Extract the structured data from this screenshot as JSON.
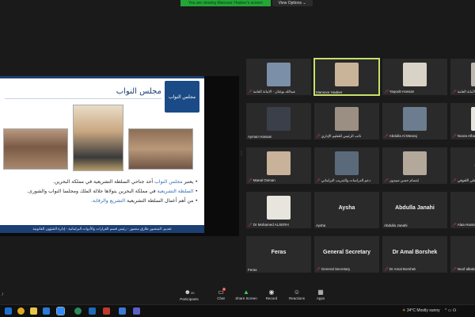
{
  "banner": {
    "share_text": "You are viewing Mansoor Hadeer's screen",
    "view_options": "View Options ⌄"
  },
  "slide": {
    "title": "مجلس النواب",
    "logo_text": "مجلس النواب",
    "bullets": [
      {
        "pre": "يعتبر ",
        "hl": "مجلس النواب",
        "post": " أحد جناحي السلطة التشريعية في مملكة البحرين."
      },
      {
        "pre": "",
        "hl": "السلطة التشريعية",
        "post": " في مملكة البحرين يتولاها جلالة الملك ومجلسا النواب والشورى."
      },
      {
        "pre": "من أهم أعمال السلطة التشريعية ",
        "hl": "التشريع والرقابة.",
        "post": ""
      }
    ],
    "footer": "تقديم: المنصور طارق منصور - رئيس قسم القرارات والأدوات البرلمانية - إدارة الشؤون القانونية"
  },
  "participants": [
    {
      "name": "عبدالله بوغتان - الامانة العامة",
      "muted": true,
      "kind": "photo",
      "color": "#7b8fa8"
    },
    {
      "name": "Mansoor Hadeer",
      "muted": false,
      "kind": "photo",
      "color": "#c9b49a",
      "active": true
    },
    {
      "name": "Yaqoob Hassan",
      "muted": true,
      "kind": "photo",
      "color": "#d9d2c6"
    },
    {
      "name": "الأمانة العامة",
      "muted": true,
      "kind": "photo",
      "color": "#bdb7ae"
    },
    {
      "name": "Ayman Hassan",
      "muted": false,
      "kind": "photo",
      "color": "#3a3f4a"
    },
    {
      "name": "نائب الرئيس للتعليم الإداري",
      "muted": true,
      "kind": "photo",
      "color": "#9a8f82"
    },
    {
      "name": "Abdulla Al Mearaj",
      "muted": true,
      "kind": "photo",
      "color": "#6b7d8f"
    },
    {
      "name": "Noora Alhamadi",
      "muted": true,
      "kind": "photo",
      "color": "#e6e2dc"
    },
    {
      "name": "Manal Osman",
      "muted": true,
      "kind": "photo",
      "color": "#c8b29a"
    },
    {
      "name": "دعم الدراسات والتدريب البرلماني",
      "muted": true,
      "kind": "photo",
      "color": "#5a6a7a"
    },
    {
      "name": "ابتسام حسن سيدون",
      "muted": true,
      "kind": "photo",
      "color": "#b4a89a"
    },
    {
      "name": "علي اللعوفي",
      "muted": true,
      "kind": "text",
      "label": "علي ال"
    },
    {
      "name": "Dr Mohamed ALSERH",
      "muted": true,
      "kind": "photo",
      "color": "#e8e4de"
    },
    {
      "name": "Aysha",
      "muted": false,
      "kind": "text",
      "label": "Aysha"
    },
    {
      "name": "Abdulla Janahi",
      "muted": false,
      "kind": "text",
      "label": "Abdulla Janahi"
    },
    {
      "name": "Alaa Hassan",
      "muted": true,
      "kind": "text",
      "label": "Ala"
    },
    {
      "name": "Feras",
      "muted": false,
      "kind": "text",
      "label": "Feras"
    },
    {
      "name": "General Secretary",
      "muted": true,
      "kind": "text",
      "label": "General Secretary"
    },
    {
      "name": "Dr Amal Borshek",
      "muted": true,
      "kind": "text",
      "label": "Dr Amal Borshek"
    },
    {
      "name": "Noof albalooshi",
      "muted": true,
      "kind": "text",
      "label": "No"
    }
  ],
  "toolbar": {
    "left_text": "ﾉ",
    "participants_label": "Participants",
    "participants_count": "20",
    "chat_label": "Chat",
    "chat_badge": "1",
    "share_label": "Share Screen",
    "record_label": "Record",
    "reactions_label": "Reactions",
    "apps_label": "Apps"
  },
  "taskbar": {
    "weather": "34°C  Mostly sunny",
    "tray": "^ ▭ ☊"
  }
}
